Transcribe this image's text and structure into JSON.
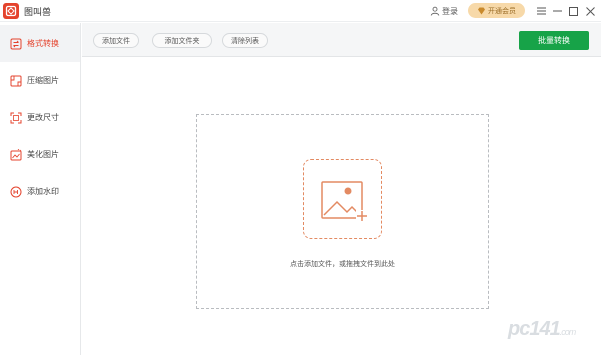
{
  "app": {
    "title": "图叫兽",
    "login_label": "登录",
    "vip_label": "开通会员",
    "accent": "#e4432d",
    "primary_green": "#17a348"
  },
  "sidebar": {
    "items": [
      {
        "label": "格式转换",
        "icon": "format-convert-icon",
        "active": true
      },
      {
        "label": "压缩图片",
        "icon": "compress-image-icon",
        "active": false
      },
      {
        "label": "更改尺寸",
        "icon": "resize-icon",
        "active": false
      },
      {
        "label": "美化图片",
        "icon": "beautify-icon",
        "active": false
      },
      {
        "label": "添加水印",
        "icon": "watermark-icon",
        "active": false
      }
    ]
  },
  "toolbar": {
    "add_file": "添加文件",
    "add_folder": "添加文件夹",
    "clear_list": "清除列表",
    "batch_convert": "批量转换"
  },
  "dropzone": {
    "hint": "点击添加文件，或拖拽文件到此处",
    "icon": "add-image-icon"
  },
  "watermark": {
    "text": "pc141",
    "suffix": ".com"
  }
}
